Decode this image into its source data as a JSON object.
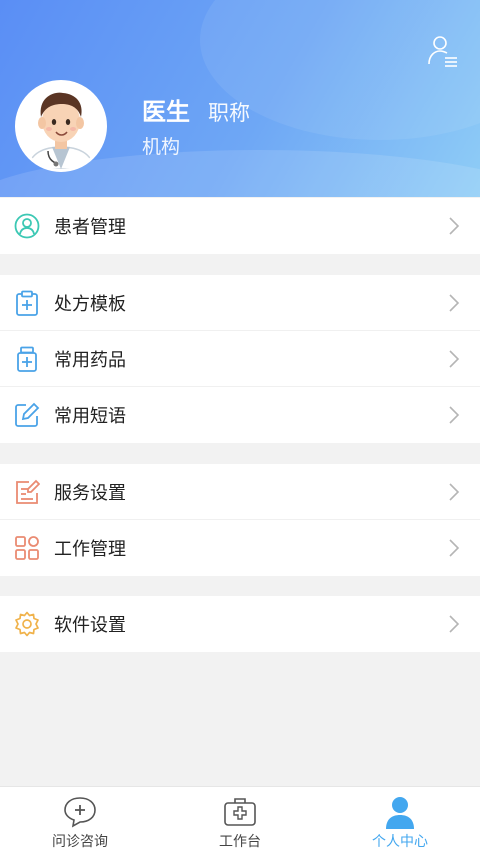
{
  "header": {
    "name": "医生",
    "title": "职称",
    "organization": "机构",
    "profile_icon": "user-settings-icon",
    "avatar": "doctor-avatar"
  },
  "menu_groups": [
    {
      "items": [
        {
          "label": "患者管理",
          "icon": "patient-icon",
          "color": "#3cc8b4"
        }
      ]
    },
    {
      "items": [
        {
          "label": "处方模板",
          "icon": "clipboard-plus-icon",
          "color": "#4aa3e8"
        },
        {
          "label": "常用药品",
          "icon": "medicine-bottle-icon",
          "color": "#4aa3e8"
        },
        {
          "label": "常用短语",
          "icon": "edit-icon",
          "color": "#4aa3e8"
        }
      ]
    },
    {
      "items": [
        {
          "label": "服务设置",
          "icon": "service-form-icon",
          "color": "#ea8b72"
        },
        {
          "label": "工作管理",
          "icon": "grid-icon",
          "color": "#ea8b72"
        }
      ]
    },
    {
      "items": [
        {
          "label": "软件设置",
          "icon": "gear-icon",
          "color": "#f0b24a"
        }
      ]
    }
  ],
  "tabbar": {
    "tabs": [
      {
        "label": "问诊咨询",
        "icon": "chat-plus-icon",
        "active": false
      },
      {
        "label": "工作台",
        "icon": "medical-kit-icon",
        "active": false
      },
      {
        "label": "个人中心",
        "icon": "person-icon",
        "active": true
      }
    ],
    "active_color": "#43a7ef"
  }
}
